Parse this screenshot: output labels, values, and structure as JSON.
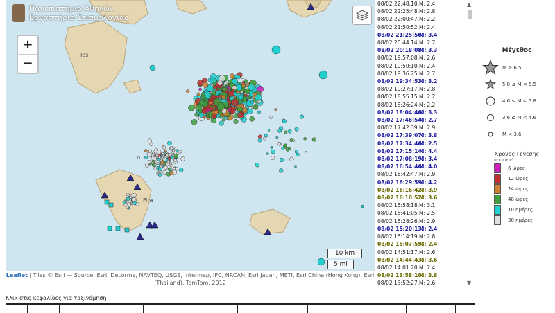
{
  "map": {
    "logo_line1": "Πανεπιστήμιο Αθηνών",
    "logo_line2": "Εργαστήριο Σεισμολογίας",
    "zoom_in": "+",
    "zoom_out": "−",
    "scale_km": "10 km",
    "scale_mi": "5 mi",
    "attribution_leaflet": "Leaflet",
    "attribution_rest": "| Tiles © Esri — Source: Esri, DeLorme, NAVTEQ, USGS, Intermap, iPC, NRCAN, Esri Japan, METI, Esri China (Hong Kong), Esri (Thailand), TomTom, 2012",
    "island_label": "Ios",
    "town_label": "Fira",
    "colors": {
      "sea": "#cfe6f0",
      "land": "#e6d7b3",
      "station": "#2a2a8a"
    }
  },
  "events": [
    {
      "t": "08/02 22:48:10.",
      "m": "M: 2.4",
      "s": ""
    },
    {
      "t": "08/02 22:25:48.",
      "m": "M: 2.8",
      "s": ""
    },
    {
      "t": "08/02 22:00:47.",
      "m": "M: 2.2",
      "s": ""
    },
    {
      "t": "08/02 21:50:52.",
      "m": "M: 2.4",
      "s": ""
    },
    {
      "t": "08/02 21:25:56.",
      "m": "M: 3.4",
      "s": "hl"
    },
    {
      "t": "08/02 20:44:14.",
      "m": "M: 2.7",
      "s": ""
    },
    {
      "t": "08/02 20:18:08.",
      "m": "M: 3.3",
      "s": "hl"
    },
    {
      "t": "08/02 19:57:08.",
      "m": "M: 2.6",
      "s": ""
    },
    {
      "t": "08/02 19:50:10.",
      "m": "M: 2.4",
      "s": ""
    },
    {
      "t": "08/02 19:36:25.",
      "m": "M: 2.7",
      "s": ""
    },
    {
      "t": "08/02 19:34:53.",
      "m": "M: 3.2",
      "s": "hl"
    },
    {
      "t": "08/02 19:27:17.",
      "m": "M: 2.8",
      "s": ""
    },
    {
      "t": "08/02 18:55:15.",
      "m": "M: 2.2",
      "s": ""
    },
    {
      "t": "08/02 18:26:24.",
      "m": "M: 2.2",
      "s": ""
    },
    {
      "t": "08/02 18:04:46.",
      "m": "M: 3.3",
      "s": "hl"
    },
    {
      "t": "08/02 17:46:54.",
      "m": "M: 2.7",
      "s": "hl"
    },
    {
      "t": "08/02 17:42:39.",
      "m": "M: 2.9",
      "s": ""
    },
    {
      "t": "08/02 17:39:07.",
      "m": "M: 3.8",
      "s": "hl"
    },
    {
      "t": "08/02 17:34:46.",
      "m": "M: 2.5",
      "s": "hl"
    },
    {
      "t": "08/02 17:15:14.",
      "m": "M: 4.4",
      "s": "hl"
    },
    {
      "t": "08/02 17:08:19.",
      "m": "M: 3.4",
      "s": "hl"
    },
    {
      "t": "08/02 16:54:46.",
      "m": "M: 4.0",
      "s": "hl"
    },
    {
      "t": "08/02 16:42:47.",
      "m": "M: 2.9",
      "s": ""
    },
    {
      "t": "08/02 16:29:59.",
      "m": "M: 4.2",
      "s": "hl"
    },
    {
      "t": "08/02 16:16:42.",
      "m": "M: 3.9",
      "s": "gr"
    },
    {
      "t": "08/02 16:10:52.",
      "m": "M: 3.6",
      "s": "gr"
    },
    {
      "t": "08/02 15:58:18.",
      "m": "M: 3.1",
      "s": ""
    },
    {
      "t": "08/02 15:41:05.",
      "m": "M: 2.5",
      "s": ""
    },
    {
      "t": "08/02 15:28:26.",
      "m": "M: 2.9",
      "s": ""
    },
    {
      "t": "08/02 15:20:13.",
      "m": "M: 2.4",
      "s": "hl"
    },
    {
      "t": "08/02 15:14:19.",
      "m": "M: 2.8",
      "s": ""
    },
    {
      "t": "08/02 15:07:55.",
      "m": "M: 2.4",
      "s": "gr"
    },
    {
      "t": "08/02 14:51:17.",
      "m": "M: 2.6",
      "s": ""
    },
    {
      "t": "08/02 14:44:43.",
      "m": "M: 3.6",
      "s": "gr"
    },
    {
      "t": "08/02 14:01:20.",
      "m": "M: 2.4",
      "s": ""
    },
    {
      "t": "08/02 13:58:10.",
      "m": "M: 3.8",
      "s": "gr"
    },
    {
      "t": "08/02 13:52:27.",
      "m": "M: 2.6",
      "s": ""
    }
  ],
  "legend": {
    "magnitude_title": "Μέγεθος",
    "mag_rows": [
      {
        "label": "M ≥ 6.5",
        "shape": "star-big"
      },
      {
        "label": "5.8 ≤ M < 6.5",
        "shape": "star-small"
      },
      {
        "label": "4.6 ≤ M < 5.8",
        "shape": "circle-big"
      },
      {
        "label": "3.6 ≤ M < 4.6",
        "shape": "circle-mid"
      },
      {
        "label": "M < 3.6",
        "shape": "circle-small"
      }
    ],
    "time_title": "Χρόνος Γένεσης",
    "time_subtitle": "πριν από",
    "time_rows": [
      {
        "label": "6 ώρες",
        "color": "#d020c0"
      },
      {
        "label": "12 ώρες",
        "color": "#c03030"
      },
      {
        "label": "24 ώρες",
        "color": "#d08030"
      },
      {
        "label": "48 ώρες",
        "color": "#40a040"
      },
      {
        "label": "10 ημέρες",
        "color": "#20d0d0"
      },
      {
        "label": "30 ημέρες",
        "color": "#e0e0e0"
      }
    ]
  },
  "footer": {
    "sort_hint": "Κλικ στις κεφαλίδες για ταξινόμηση"
  }
}
